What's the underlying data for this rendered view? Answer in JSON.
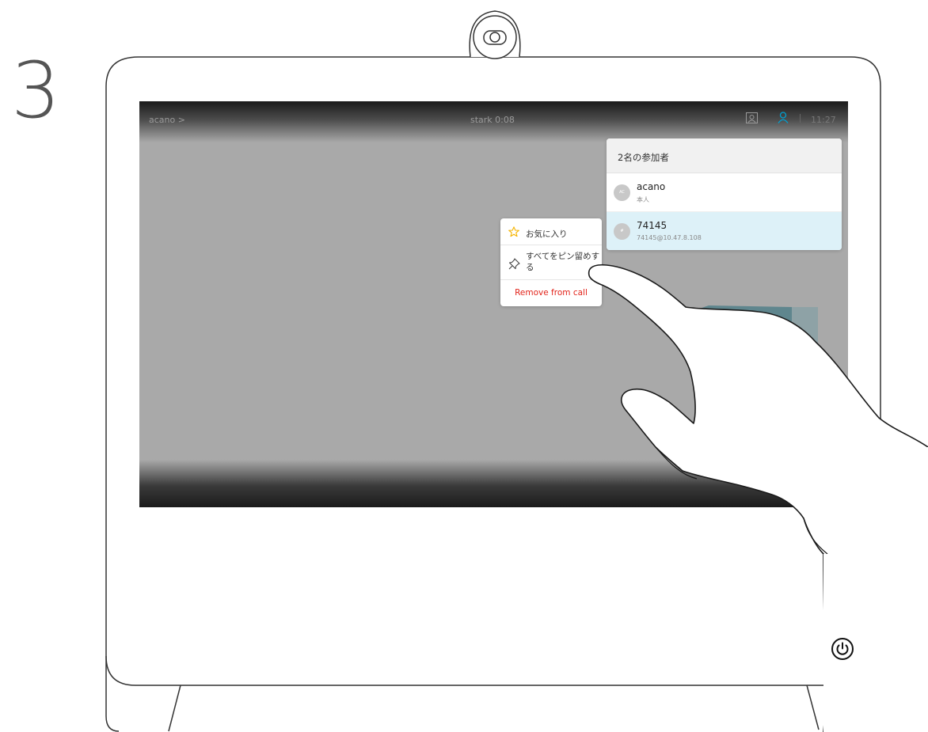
{
  "step_number": "3",
  "topbar": {
    "breadcrumb": "acano >",
    "call_title": "stark  0:08",
    "clock": "11:27"
  },
  "participants_panel": {
    "title": "2名の参加者",
    "participants": [
      {
        "avatar": "AC",
        "name": "acano",
        "subtitle": "本人",
        "selected": false
      },
      {
        "avatar": "#",
        "name": "74145",
        "subtitle": "74145@10.47.8.108",
        "selected": true
      }
    ]
  },
  "context_menu": {
    "favorite_label": "お気に入り",
    "pin_label": "すべてをピン留めする",
    "remove_label": "Remove from call"
  },
  "colors": {
    "accent": "#00a0d1",
    "danger": "#e2231a",
    "star": "#f5b400",
    "selected_row": "#ddf1f8"
  },
  "icons": [
    "camera-icon",
    "self-view-icon",
    "participants-icon",
    "star-icon",
    "pin-icon",
    "power-icon"
  ]
}
